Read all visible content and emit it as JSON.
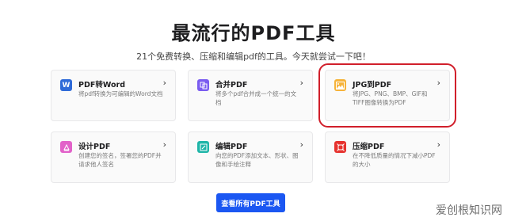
{
  "header": {
    "title": "最流行的PDF工具",
    "subtitle": "21个免费转换、压缩和编辑pdf的工具。今天就尝试一下吧！"
  },
  "tools": [
    {
      "name": "PDF转Word",
      "desc": "将pdf转换为可编辑的Word文档",
      "icon": "word-icon",
      "color": "#2f6bd8"
    },
    {
      "name": "合并PDF",
      "desc": "将多个pdf合并成一个统一的文档",
      "icon": "merge-icon",
      "color": "#7a5cf0"
    },
    {
      "name": "JPG到PDF",
      "desc": "将JPG、PNG、BMP、GIF和TIFF图像转换为PDF",
      "icon": "image-icon",
      "color": "#f6b33a"
    },
    {
      "name": "设计PDF",
      "desc": "创建您的签名，签署您的PDF并请求他人签名",
      "icon": "sign-icon",
      "color": "#e262c9"
    },
    {
      "name": "编辑PDF",
      "desc": "向您的PDF添加文本、形状、图像和手绘注释",
      "icon": "edit-icon",
      "color": "#1fb5a8"
    },
    {
      "name": "压缩PDF",
      "desc": "在不降低质量的情况下减小PDF的大小",
      "icon": "compress-icon",
      "color": "#e6322e"
    }
  ],
  "chevron": "›",
  "cta": {
    "label": "查看所有PDF工具"
  },
  "watermark": "爱创根知识网",
  "colors": {
    "accent": "#1b57f2",
    "highlight": "#d11f2b"
  }
}
